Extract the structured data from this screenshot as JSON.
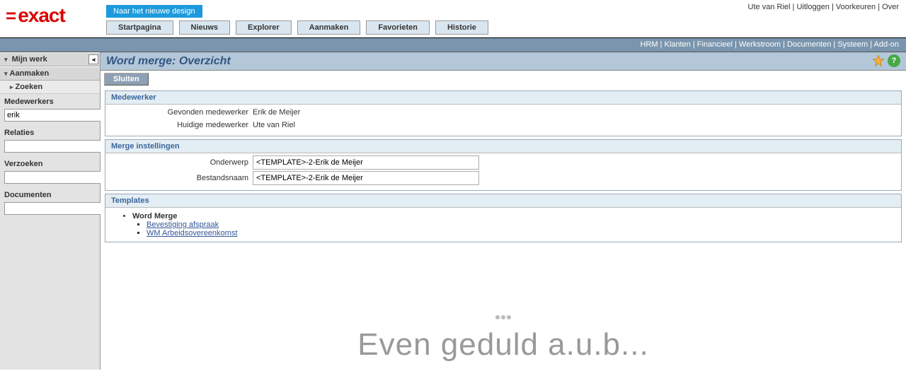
{
  "header": {
    "logo": "exact",
    "new_design_button": "Naar het nieuwe design",
    "top_links": [
      "Ute van Riel",
      "Uitloggen",
      "Voorkeuren",
      "Over"
    ],
    "tabs": [
      "Startpagina",
      "Nieuws",
      "Explorer",
      "Aanmaken",
      "Favorieten",
      "Historie"
    ]
  },
  "subnav": [
    "HRM",
    "Klanten",
    "Financieel",
    "Werkstroom",
    "Documenten",
    "Systeem",
    "Add-on"
  ],
  "sidebar": {
    "mijn_werk": "Mijn werk",
    "aanmaken": "Aanmaken",
    "zoeken": "Zoeken",
    "groups": {
      "medewerkers": {
        "label": "Medewerkers",
        "value": "erik"
      },
      "relaties": {
        "label": "Relaties",
        "value": ""
      },
      "verzoeken": {
        "label": "Verzoeken",
        "value": ""
      },
      "documenten": {
        "label": "Documenten",
        "value": ""
      }
    }
  },
  "page": {
    "title": "Word merge: Overzicht",
    "close_btn": "Sluiten"
  },
  "panels": {
    "medewerker": {
      "heading": "Medewerker",
      "rows": {
        "found_label": "Gevonden medewerker",
        "found_value": "Erik de Meijer",
        "current_label": "Huidige medewerker",
        "current_value": "Ute van Riel"
      }
    },
    "merge": {
      "heading": "Merge instellingen",
      "rows": {
        "subject_label": "Onderwerp",
        "subject_value": "<TEMPLATE>-2-Erik de Meijer",
        "filename_label": "Bestandsnaam",
        "filename_value": "<TEMPLATE>-2-Erik de Meijer"
      }
    },
    "templates": {
      "heading": "Templates",
      "root": "Word Merge",
      "items": [
        "Bevestiging afspraak",
        "WM Arbeidsovereenkomst"
      ]
    }
  },
  "loading_text": "Even geduld a.u.b..."
}
